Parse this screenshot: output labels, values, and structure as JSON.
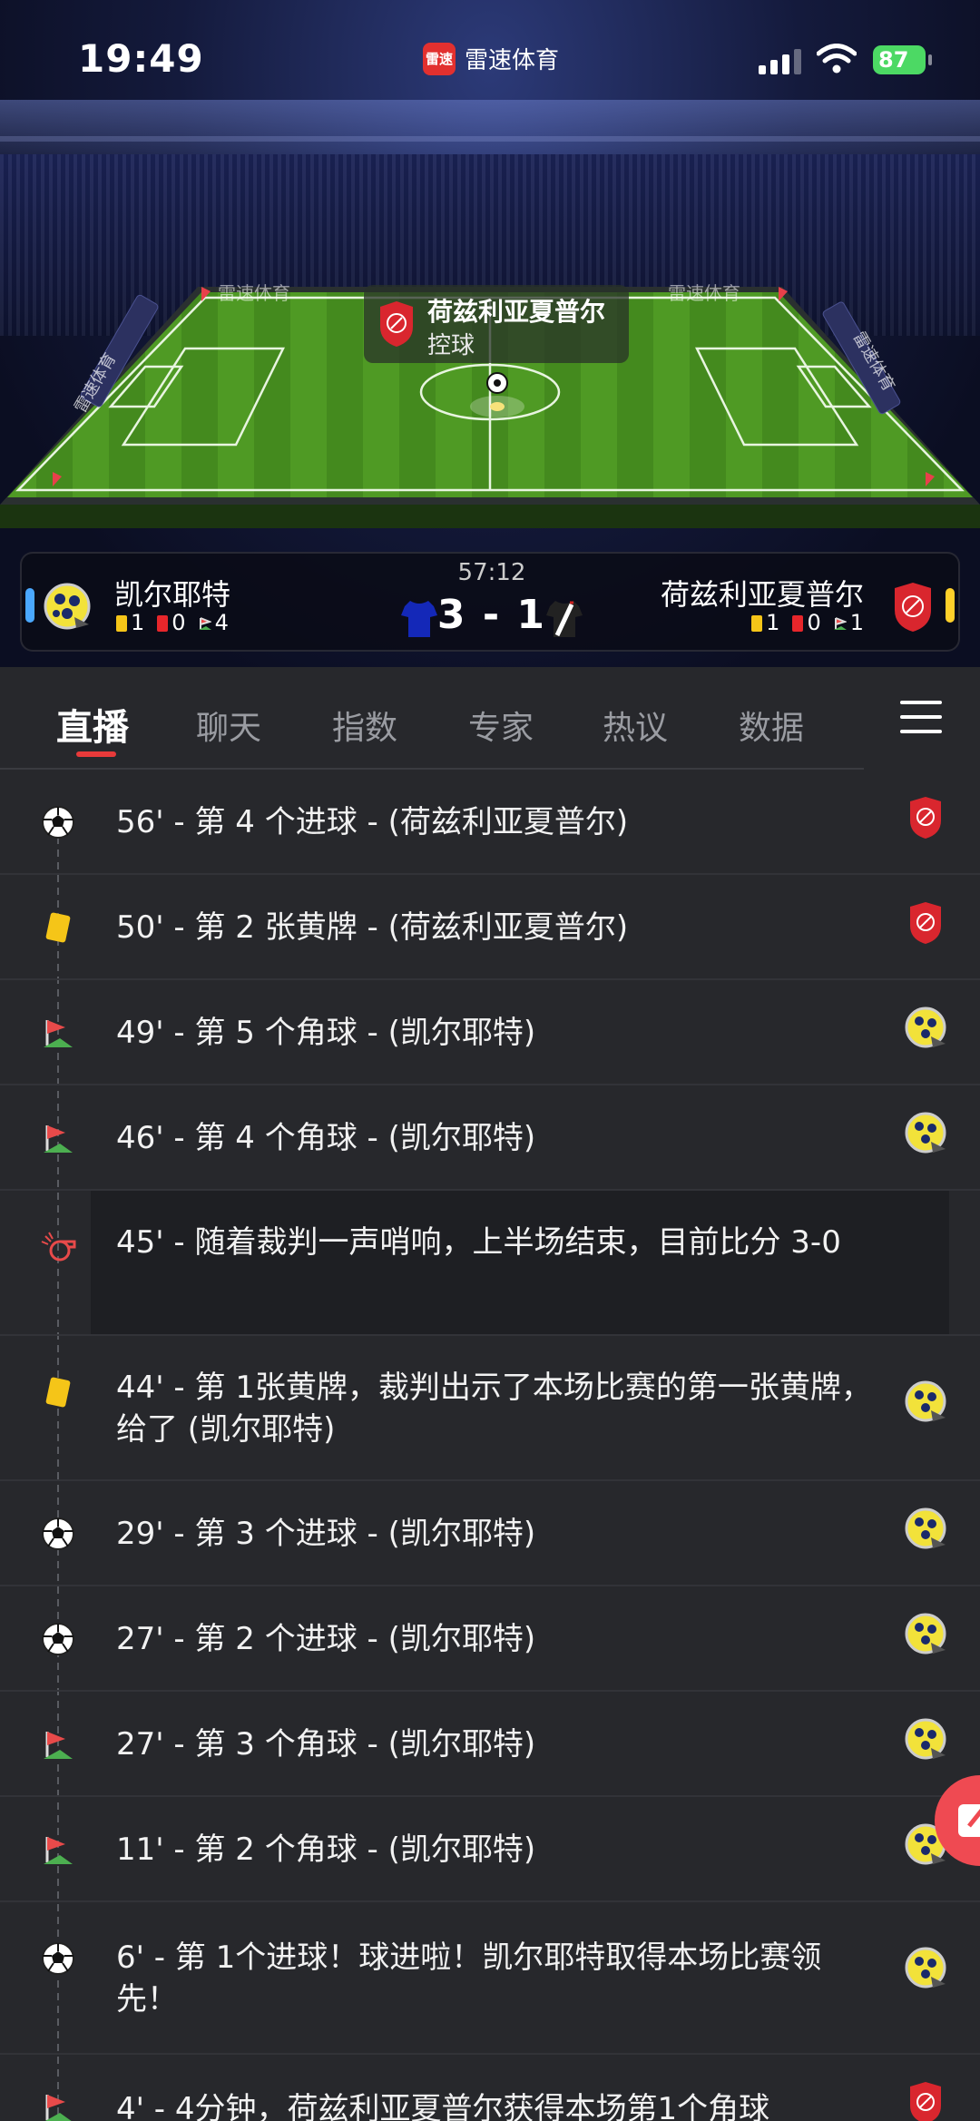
{
  "status_bar": {
    "time": "19:49",
    "app_name": "雷速体育",
    "app_logo_text": "雷速",
    "battery": "87"
  },
  "stadium": {
    "brand_watermark": "雷速体育"
  },
  "possession": {
    "team": "荷兹利亚夏普尔",
    "label": "控球"
  },
  "scoreboard": {
    "match_clock": "57:12",
    "score": "3 - 1",
    "home": {
      "name": "凯尔耶特",
      "yellow": "1",
      "red": "0",
      "corners": "4",
      "bar_color": "#4aa8ff"
    },
    "away": {
      "name": "荷兹利亚夏普尔",
      "yellow": "1",
      "red": "0",
      "corners": "1",
      "bar_color": "#ffd02a"
    }
  },
  "tabs": [
    {
      "label": "直播",
      "active": true
    },
    {
      "label": "聊天"
    },
    {
      "label": "指数"
    },
    {
      "label": "专家"
    },
    {
      "label": "热议"
    },
    {
      "label": "数据"
    }
  ],
  "events": [
    {
      "type": "goal-icon",
      "team": "away",
      "text": "56' - 第 4 个进球 - (荷兹利亚夏普尔)"
    },
    {
      "type": "yellow-card-icon",
      "team": "away",
      "text": "50' - 第 2 张黄牌 - (荷兹利亚夏普尔)"
    },
    {
      "type": "corner-flag-icon",
      "team": "home",
      "text": "49' - 第 5 个角球 - (凯尔耶特)"
    },
    {
      "type": "corner-flag-icon",
      "team": "home",
      "text": "46' - 第 4 个角球 - (凯尔耶特)"
    },
    {
      "type": "whistle-icon",
      "team": "",
      "text": "45' - 随着裁判一声哨响，上半场结束，目前比分 3-0"
    },
    {
      "type": "yellow-card-icon",
      "team": "home",
      "text": "44' - 第 1张黄牌，裁判出示了本场比赛的第一张黄牌，给了 (凯尔耶特)"
    },
    {
      "type": "goal-icon",
      "team": "home",
      "text": "29' - 第 3 个进球 - (凯尔耶特)"
    },
    {
      "type": "goal-icon",
      "team": "home",
      "text": "27' - 第 2 个进球 - (凯尔耶特)"
    },
    {
      "type": "corner-flag-icon",
      "team": "home",
      "text": "27' - 第 3 个角球 - (凯尔耶特)"
    },
    {
      "type": "corner-flag-icon",
      "team": "home",
      "text": "11' - 第 2 个角球 - (凯尔耶特)"
    },
    {
      "type": "goal-icon",
      "team": "home",
      "text": "6' - 第 1个进球！球进啦！凯尔耶特取得本场比赛领先！"
    },
    {
      "type": "corner-flag-icon",
      "team": "away",
      "text": "4' - 4分钟，荷兹利亚夏普尔获得本场第1个角球"
    }
  ],
  "colors": {
    "accent": "#e83a3a",
    "background": "#27282c",
    "pitch": "#4a8f22"
  }
}
